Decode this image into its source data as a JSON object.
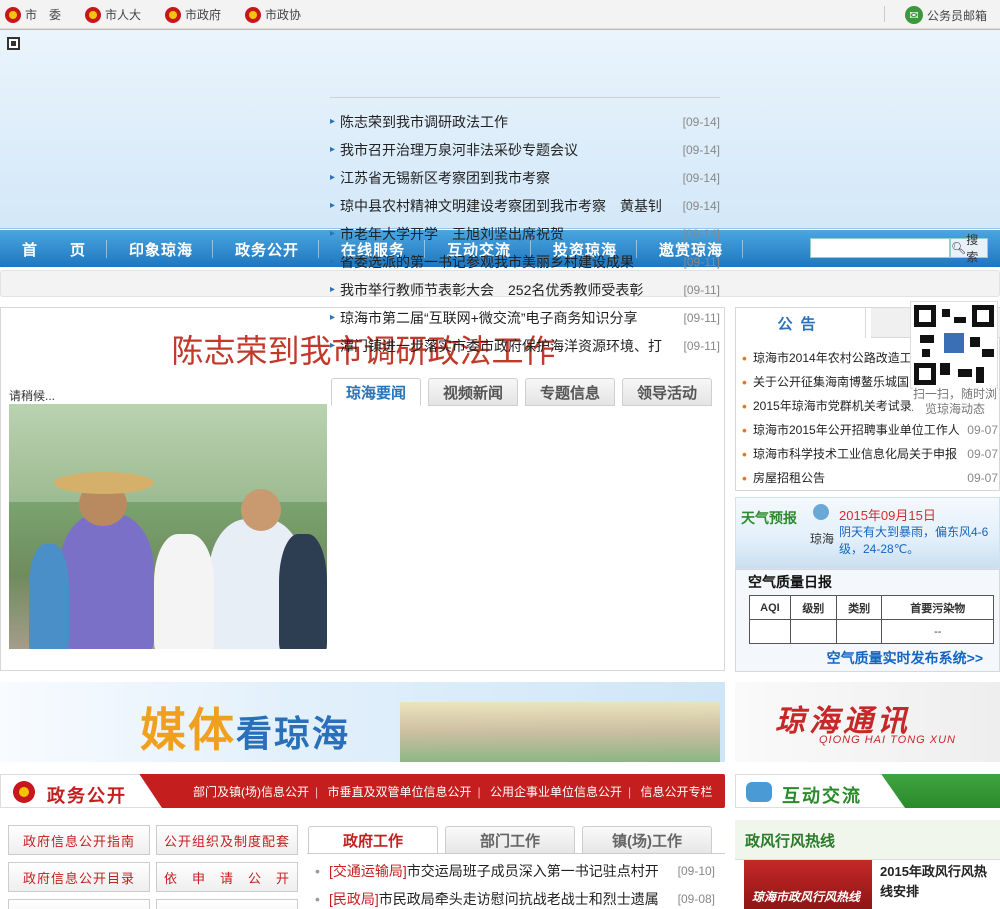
{
  "topbar": {
    "links": [
      "市　委",
      "市人大",
      "市政府",
      "市政协"
    ],
    "mail": "公务员邮箱"
  },
  "nav": {
    "items": [
      "首　　页",
      "印象琼海",
      "政务公开",
      "在线服务",
      "互动交流",
      "投资琼海",
      "遨赏琼海"
    ],
    "search_label": "搜索"
  },
  "headline": "陈志荣到我市调研政法工作",
  "loading_text": "请稍候...",
  "news_tabs": [
    "琼海要闻",
    "视频新闻",
    "专题信息",
    "领导活动"
  ],
  "news": [
    {
      "title": "陈志荣到我市调研政法工作",
      "date": "[09-14]"
    },
    {
      "title": "我市召开治理万泉河非法采砂专题会议",
      "date": "[09-14]"
    },
    {
      "title": "江苏省无锡新区考察团到我市考察",
      "date": "[09-14]"
    },
    {
      "title": "琼中县农村精神文明建设考察团到我市考察　黄基钊",
      "date": "[09-14]"
    },
    {
      "title": "市老年大学开学　王旭刘坚出席祝贺",
      "date": "[09-14]"
    },
    {
      "title": "省委选派的第一书记参观我市美丽乡村建设成果",
      "date": "[09-11]"
    },
    {
      "title": "我市举行教师节表彰大会　252名优秀教师受表彰",
      "date": "[09-11]"
    },
    {
      "title": "琼海市第二届“互联网+微交流”电子商务知识分享",
      "date": "[09-11]"
    },
    {
      "title": "潭门镇进一步落实市委市政府保护海洋资源环境、打",
      "date": "[09-11]"
    }
  ],
  "notice": {
    "tab": "公告",
    "items": [
      {
        "title": "琼海市2014年农村公路改造工程",
        "date": ""
      },
      {
        "title": "关于公开征集海南博鳌乐城国际",
        "date": ""
      },
      {
        "title": "2015年琼海市党群机关考试录用",
        "date": ""
      },
      {
        "title": "琼海市2015年公开招聘事业单位工作人",
        "date": "09-07"
      },
      {
        "title": "琼海市科学技术工业信息化局关于申报",
        "date": "09-07"
      },
      {
        "title": "房屋招租公告",
        "date": "09-07"
      }
    ]
  },
  "qr_text": "扫一扫，随时浏览琼海动态",
  "weather": {
    "title": "天气预报",
    "city": "琼海",
    "date": "2015年09月15日",
    "desc": "阴天有大到暴雨，偏东风4-6级，24-28℃。"
  },
  "air": {
    "title": "空气质量日报",
    "headers": [
      "AQI",
      "级别",
      "类别",
      "首要污染物"
    ],
    "row": [
      "",
      "",
      "",
      "--"
    ],
    "link": "空气质量实时发布系统>>"
  },
  "media_banner": {
    "part1": "媒体",
    "part2": "看琼海"
  },
  "tongxun": {
    "title": "琼海通讯",
    "sub": "QIONG HAI TONG XUN"
  },
  "zw": {
    "title": "政务公开",
    "links": [
      "部门及镇(场)信息公开",
      "市垂直及双管单位信息公开",
      "公用企事业单位信息公开",
      "信息公开专栏"
    ],
    "buttons": [
      "政府信息公开指南",
      "公开组织及制度配套",
      "政府信息公开目录",
      "依　申　请　公　开"
    ],
    "tabs": [
      "政府工作",
      "部门工作",
      "镇(场)工作"
    ],
    "news": [
      {
        "cat": "[交通运输局]",
        "title": "市交运局班子成员深入第一书记驻点村开",
        "date": "[09-10]"
      },
      {
        "cat": "[民政局]",
        "title": "市民政局牵头走访慰问抗战老战士和烈士遗属",
        "date": "[09-08]"
      }
    ]
  },
  "hd": {
    "title": "互动交流",
    "sub": "政风行风热线",
    "img_text": "琼海市政风行风热线",
    "news": "2015年政风行风热线安排"
  },
  "colors": {
    "nav": "#1f76be",
    "accent_red": "#c41e1e",
    "accent_green": "#2a8a2a",
    "link_blue": "#2a73b8"
  }
}
